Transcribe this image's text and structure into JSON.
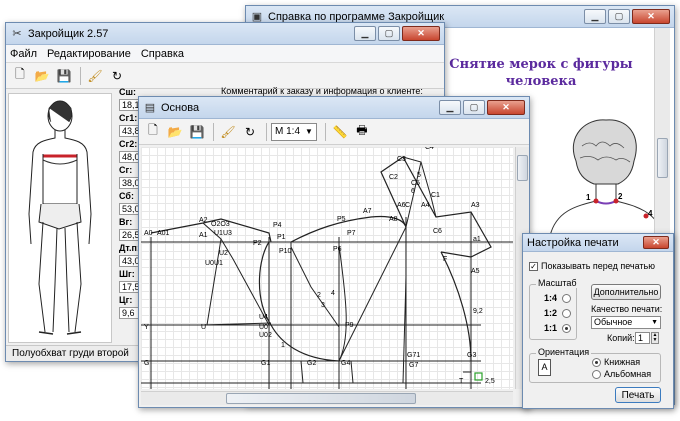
{
  "help_window": {
    "title": "Справка по программе Закройщик",
    "heading_line1": "Снятие мерок с фигуры",
    "heading_line2": "человека",
    "heading_color": "#5b2a9e"
  },
  "main_window": {
    "title": "Закройщик 2.57",
    "menu": [
      "Файл",
      "Редактирование",
      "Справка"
    ],
    "scale": "М 1:4",
    "comment_label": "Комментарий к заказу и информация о клиенте:",
    "status": "Полуобхват груди второй",
    "measurements": [
      {
        "label": "Сш:",
        "value": "18,1"
      },
      {
        "label": "Сг1:",
        "value": "43,8"
      },
      {
        "label": "Сг2:",
        "value": "48,0"
      },
      {
        "label": "Сг:",
        "value": "38,0"
      },
      {
        "label": "Сб:",
        "value": "53,0"
      },
      {
        "label": "Вг:",
        "value": "26,5"
      },
      {
        "label": "Дт.п:",
        "value": "43,0"
      },
      {
        "label": "Шг:",
        "value": "17,5"
      },
      {
        "label": "Цг:",
        "value": "9,6"
      }
    ]
  },
  "base_window": {
    "title": "Основа",
    "scale": "М 1:4",
    "pattern_labels": {
      "A0": "A0",
      "A01": "A01",
      "A1": "A1",
      "A2": "A2",
      "O3": "O3",
      "O2O3": "O2O3",
      "O2": "O2",
      "U1U3": "U1U3",
      "P": "P",
      "P4": "P4",
      "P2": "P2",
      "P1": "P1",
      "P10": "P10",
      "U2": "U2",
      "U0U1": "U0U1",
      "U4": "U4",
      "U": "U",
      "Y": "Y",
      "U0": "U0",
      "U02": "U02",
      "G": "G",
      "G1": "G1",
      "G2": "G2",
      "G4": "G4",
      "P5": "P5",
      "P6": "P6",
      "P7": "P7",
      "A7": "A7",
      "A8": "A8",
      "P9": "P9",
      "A6": "A6",
      "A5": "A5",
      "A4": "A4",
      "A3": "A3",
      "a1": "a1",
      "C": "C",
      "C1": "C1",
      "C2": "C2",
      "C3": "C3",
      "C4": "C4",
      "C5": "C5",
      "C6": "C6",
      "F": "F",
      "G3": "G3",
      "G71": "G71",
      "G7": "G7",
      "n1": "1",
      "n2": "2",
      "n3": "3",
      "n4": "4",
      "n5": "5",
      "n6": "6",
      "n92": "9,2",
      "n25": "2,5",
      "T": "T"
    }
  },
  "print_dialog": {
    "title": "Настройка печати",
    "show_before_print": "Показывать перед печатью",
    "scale_group": "Масштаб",
    "scales": [
      "1:4",
      "1:2",
      "1:1"
    ],
    "scale_selected": "1:1",
    "additional_button": "Дополнительно",
    "quality_label": "Качество печати:",
    "quality_value": "Обычное",
    "copies_label": "Копий:",
    "copies_value": "1",
    "orientation_group": "Ориентация",
    "orientation_options": [
      "Книжная",
      "Альбомная"
    ],
    "orientation_selected": "Книжная",
    "print_button": "Печать"
  },
  "icons": [
    "new-file-icon",
    "open-folder-icon",
    "save-icon",
    "brush-icon",
    "rotate-icon",
    "ruler-icon",
    "printer-icon",
    "pencil-icon"
  ]
}
